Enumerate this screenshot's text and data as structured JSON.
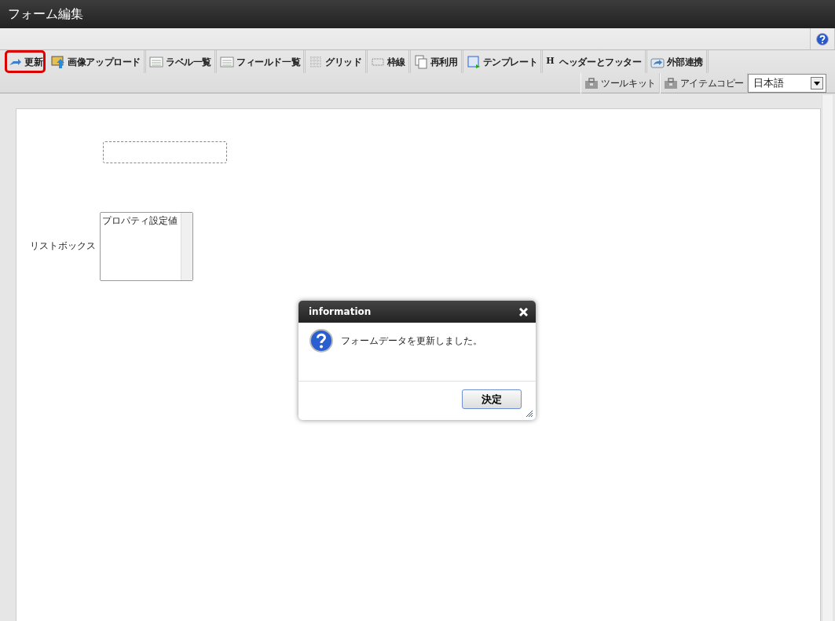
{
  "window": {
    "title": "フォーム編集"
  },
  "toolbar": {
    "row_1": [
      {
        "label": "更新",
        "highlighted": true
      },
      {
        "label": "画像アップロード",
        "highlighted": false
      },
      {
        "label": "ラベル一覧",
        "highlighted": false
      },
      {
        "label": "フィールド一覧",
        "highlighted": false
      },
      {
        "label": "グリッド",
        "highlighted": false
      },
      {
        "label": "枠線",
        "highlighted": false
      },
      {
        "label": "再利用",
        "highlighted": false
      },
      {
        "label": "テンプレート",
        "highlighted": false
      },
      {
        "label": "ヘッダーとフッター",
        "glyph": "H",
        "highlighted": false
      },
      {
        "label": "外部連携",
        "highlighted": false
      }
    ],
    "row_2": [
      {
        "label": "ツールキット",
        "highlighted": false
      },
      {
        "label": "アイテムコピー",
        "highlighted": false
      }
    ],
    "language": {
      "value": "日本語"
    }
  },
  "canvas": {
    "items": [
      {
        "kind": "placeholder"
      },
      {
        "kind": "listbox",
        "label": "リストボックス",
        "options": [
          "プロパティ設定値"
        ]
      }
    ]
  },
  "dialog": {
    "title": "information",
    "message": "フォームデータを更新しました。",
    "button": "決定"
  }
}
